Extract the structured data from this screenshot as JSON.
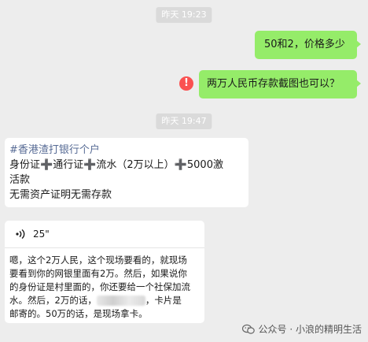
{
  "timestamps": [
    "昨天 19:23",
    "昨天 19:47"
  ],
  "messages": {
    "sent1": "50和2，价格多少",
    "sent2": "两万人民币存款截图也可以？",
    "failed_icon": "!",
    "received1": {
      "hashtag": "#香港渣打银行个户",
      "line2_parts": [
        "身份证",
        "通行证",
        "流水（2万以上）",
        "5000激"
      ],
      "line3": "活款",
      "line4": "无需资产证明无需存款",
      "plus_glyph": "➕"
    },
    "voice": {
      "icon": "voice-wave-icon",
      "duration": "25\"",
      "transcript_lines": [
        "嗯，这个2万人民，这个现场要看的，就现场",
        "要看到你的网银里面有2万。然后，如果说你",
        "的身份证是村里面的，你还要给一个社保加流",
        "水。然后，2万的话，",
        "，卡片是",
        "邮寄的。50万的话，是现场拿卡。"
      ]
    }
  },
  "watermark": {
    "icon": "wechat-official-account-icon",
    "text": "公众号 · 小浪的精明生活"
  },
  "colors": {
    "background": "#ededed",
    "sent_bubble": "#95ec69",
    "received_bubble": "#ffffff",
    "error": "#fa5151",
    "hashtag": "#576b95"
  }
}
